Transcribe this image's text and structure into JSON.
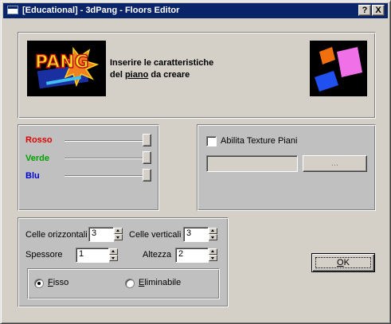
{
  "window": {
    "title": "[Educational] - 3dPang - Floors Editor",
    "help_glyph": "?",
    "close_glyph": "X"
  },
  "header": {
    "line1": "Inserire le caratteristiche",
    "line2_before": "del ",
    "line2_link": "piano",
    "line2_after": " da creare",
    "logo_text": "PANG"
  },
  "colors": {
    "red": {
      "label": "Rosso",
      "value": 1.0,
      "color": "#e00000"
    },
    "green": {
      "label": "Verde",
      "value": 1.0,
      "color": "#00a000"
    },
    "blue": {
      "label": "Blu",
      "value": 1.0,
      "color": "#0000d8"
    }
  },
  "texture": {
    "checkbox_label": "Abilita Texture Piani",
    "checked": false,
    "path_value": "",
    "browse_label": "..."
  },
  "cells": {
    "horizontal_label": "Celle orizzontali",
    "horizontal_value": "3",
    "vertical_label": "Celle verticali",
    "vertical_value": "3",
    "thickness_label": "Spessore",
    "thickness_value": "1",
    "height_label": "Altezza",
    "height_value": "2"
  },
  "type": {
    "fixed_label_initial": "F",
    "fixed_label_rest": "isso",
    "removable_label_initial": "E",
    "removable_label_rest": "liminabile",
    "selected": "fixed"
  },
  "ok_button": {
    "label_initial": "O",
    "label_rest": "K"
  }
}
